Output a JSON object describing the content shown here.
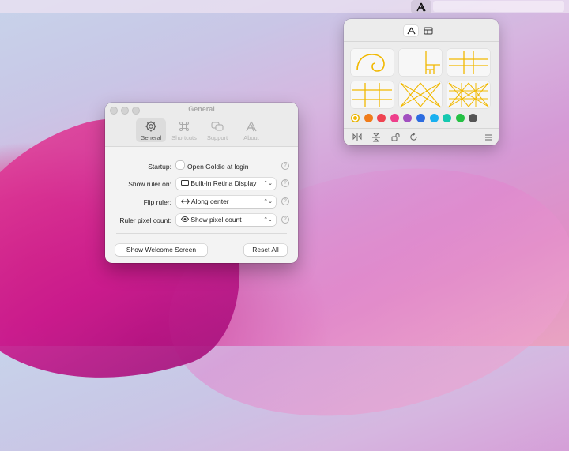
{
  "menubar": {
    "app_icon": "goldie-icon"
  },
  "popover": {
    "tabs": [
      {
        "icon": "goldie-icon",
        "active": true
      },
      {
        "icon": "layout-icon",
        "active": false
      }
    ],
    "grid_tiles": [
      {
        "name": "golden-spiral-tile"
      },
      {
        "name": "golden-rectangle-tile"
      },
      {
        "name": "phi-grid-tile"
      },
      {
        "name": "thirds-grid-tile"
      },
      {
        "name": "diagonal-lines-tile"
      },
      {
        "name": "harmonic-armature-tile"
      }
    ],
    "colors": [
      "#f1b800",
      "#f07c1a",
      "#ef4351",
      "#ee3f8b",
      "#a24fc0",
      "#2c6ce0",
      "#19b0f0",
      "#15c8b0",
      "#25c145",
      "#555555"
    ],
    "selected_color_index": 0,
    "bottom_icons": [
      "flip-horizontal-icon",
      "flip-vertical-icon",
      "lock-icon",
      "rotate-icon",
      "menu-icon"
    ]
  },
  "window": {
    "title": "General",
    "toolbar": [
      {
        "label": "General",
        "icon": "gear-icon",
        "active": true
      },
      {
        "label": "Shortcuts",
        "icon": "command-icon",
        "active": false
      },
      {
        "label": "Support",
        "icon": "chat-bubbles-icon",
        "active": false
      },
      {
        "label": "About",
        "icon": "goldie-icon",
        "active": false
      }
    ],
    "rows": {
      "startup": {
        "label": "Startup:",
        "checkbox_label": "Open Goldie at login",
        "checked": false
      },
      "show_ruler": {
        "label": "Show ruler on:",
        "value": "Built-in Retina Display"
      },
      "flip_ruler": {
        "label": "Flip ruler:",
        "value": "Along center"
      },
      "pixel_count": {
        "label": "Ruler pixel count:",
        "value": "Show pixel count"
      }
    },
    "help_glyph": "?",
    "buttons": {
      "welcome": "Show Welcome Screen",
      "reset": "Reset All"
    }
  }
}
